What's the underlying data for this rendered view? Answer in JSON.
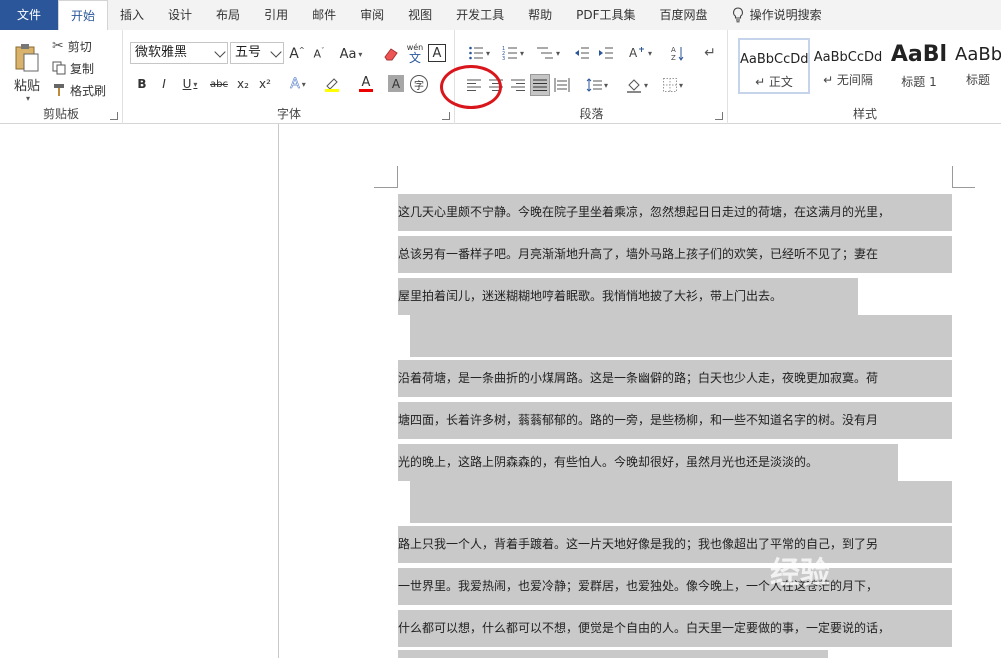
{
  "tabs": [
    "文件",
    "开始",
    "插入",
    "设计",
    "布局",
    "引用",
    "邮件",
    "审阅",
    "视图",
    "开发工具",
    "帮助",
    "PDF工具集",
    "百度网盘",
    "操作说明搜索"
  ],
  "clipboard": {
    "paste": "粘贴",
    "cut": "剪切",
    "copy": "复制",
    "format_painter": "格式刷",
    "label": "剪贴板"
  },
  "font": {
    "family": "微软雅黑",
    "size": "五号",
    "change_case": "Aa",
    "label": "字体",
    "bold": "B",
    "italic": "I",
    "underline": "U",
    "strike": "abc",
    "sub": "x₂",
    "sup": "x²",
    "effects": "A",
    "color": "A",
    "shade": "A",
    "enclose": "字",
    "phonetic_top": "wén",
    "phonetic_bottom": "文",
    "border": "A"
  },
  "paragraph": {
    "label": "段落"
  },
  "styles": {
    "label": "样式",
    "items": [
      {
        "sample": "AaBbCcDd",
        "name": "↵ 正文"
      },
      {
        "sample": "AaBbCcDd",
        "name": "↵ 无间隔"
      },
      {
        "sample": "AaBl",
        "name": "标题 1"
      },
      {
        "sample": "AaBb",
        "name": "标题"
      }
    ]
  },
  "document": {
    "paragraphs": [
      [
        "这几天心里颇不宁静。今晚在院子里坐着乘凉，忽然想起日日走过的荷塘，在这满月的光里，",
        "总该另有一番样子吧。月亮渐渐地升高了，墙外马路上孩子们的欢笑，已经听不见了；妻在",
        "屋里拍着闰儿，迷迷糊糊地哼着眠歌。我悄悄地披了大衫，带上门出去。"
      ],
      [
        "沿着荷塘，是一条曲折的小煤屑路。这是一条幽僻的路；白天也少人走，夜晚更加寂寞。荷",
        "塘四面，长着许多树，蓊蓊郁郁的。路的一旁，是些杨柳，和一些不知道名字的树。没有月",
        "光的晚上，这路上阴森森的，有些怕人。今晚却很好，虽然月光也还是淡淡的。"
      ],
      [
        "路上只我一个人，背着手踱着。这一片天地好像是我的；我也像超出了平常的自己，到了另",
        "一世界里。我爱热闹，也爱冷静；爱群居，也爱独处。像今晚上，一个人在这苍茫的月下，",
        "什么都可以想，什么都可以不想，便觉是个自由的人。白天里一定要做的事，一定要说的话，"
      ]
    ]
  },
  "watermark": "经验"
}
